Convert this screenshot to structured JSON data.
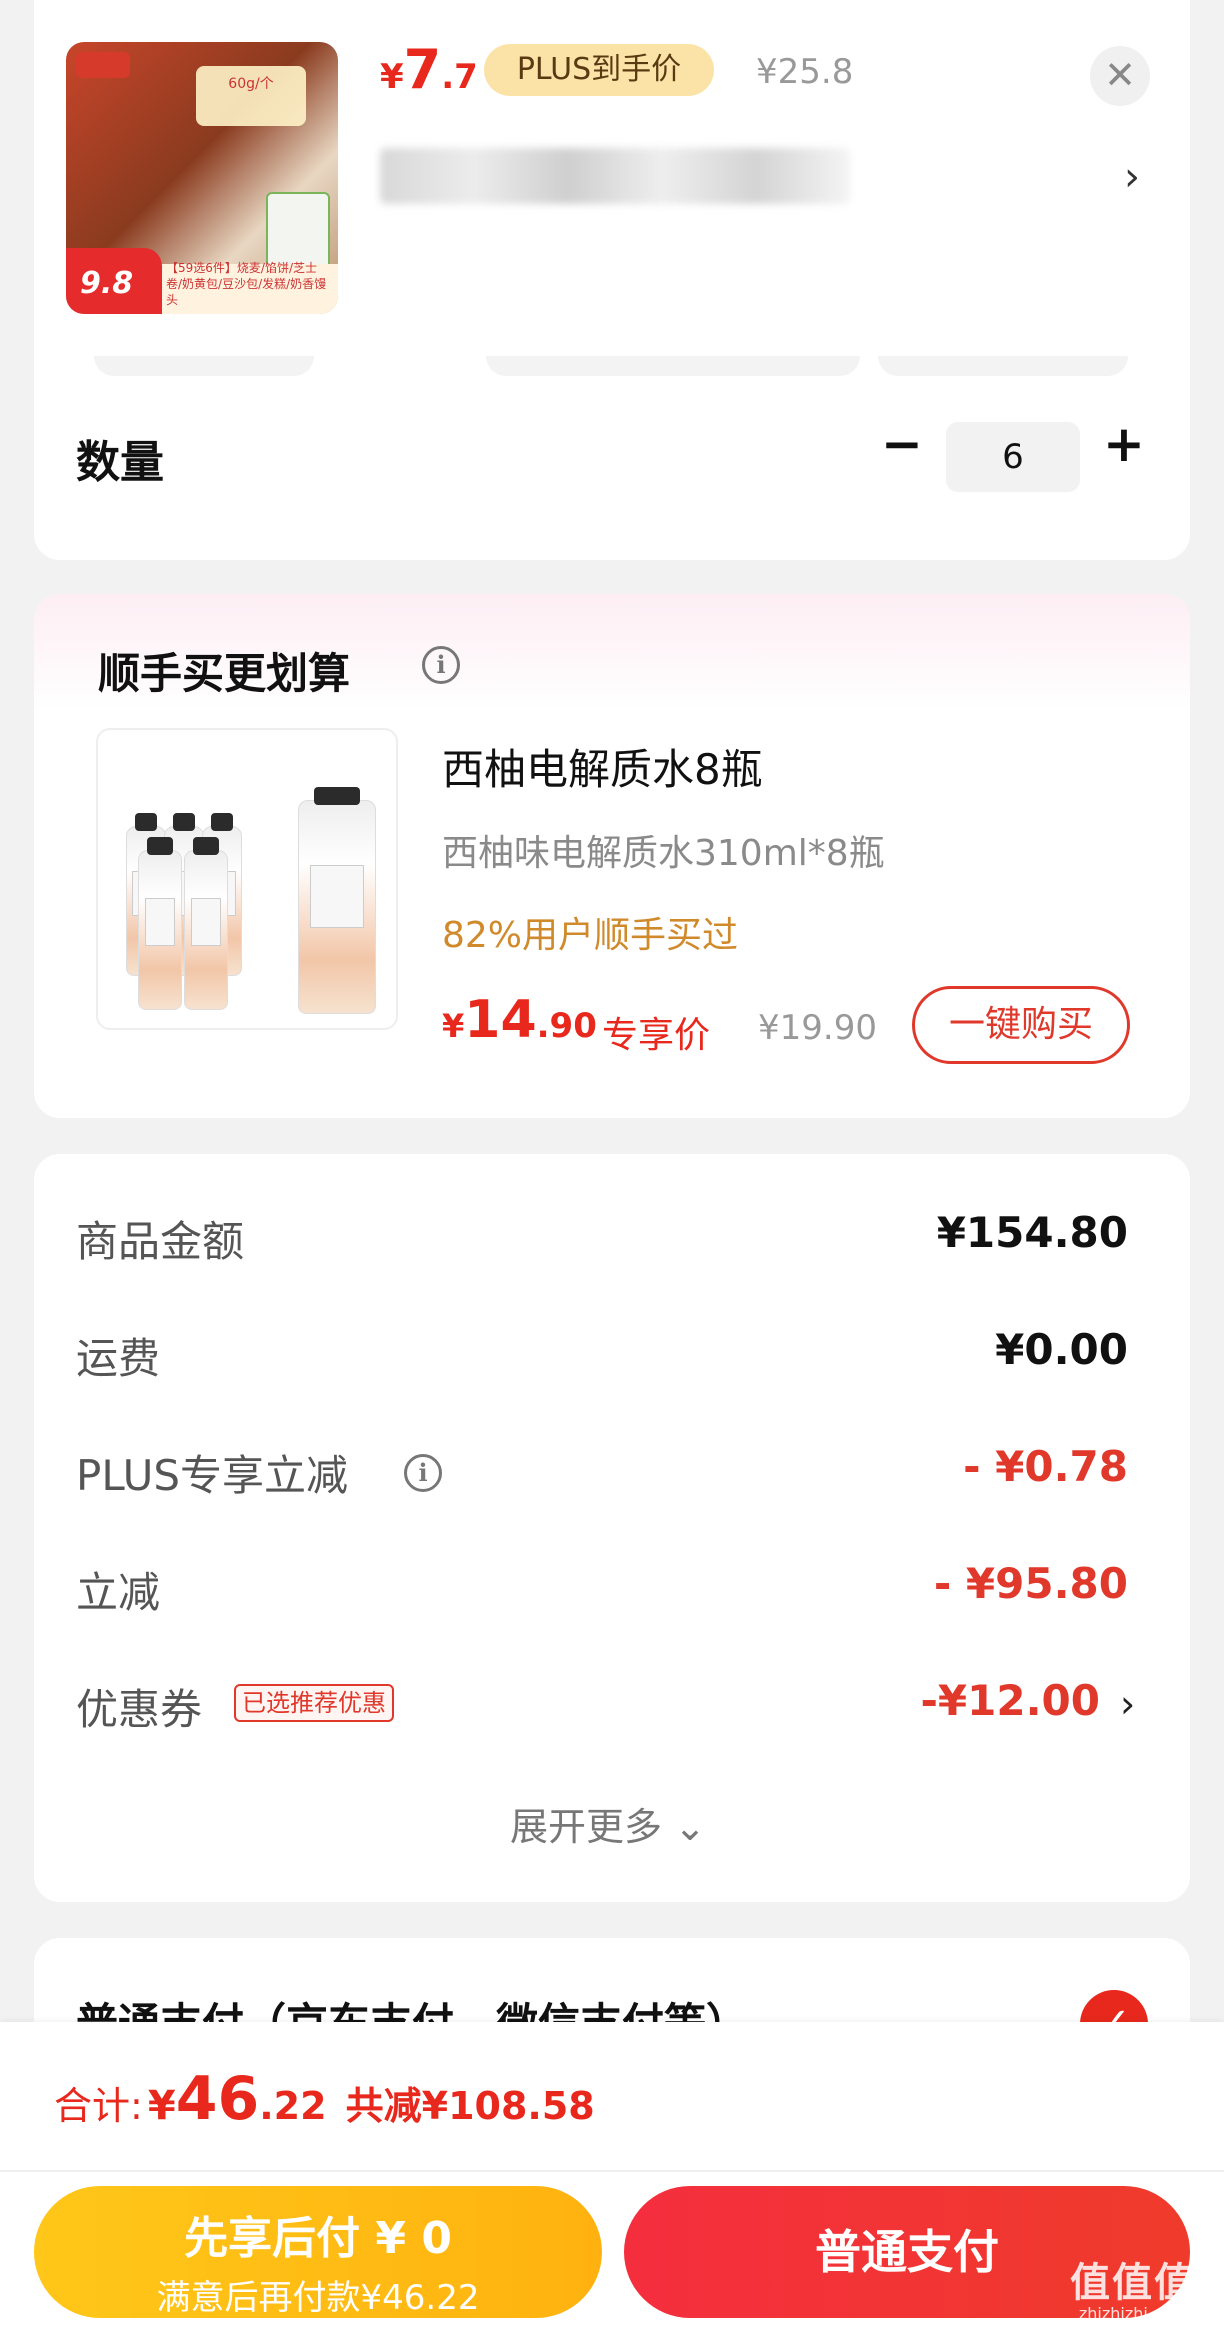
{
  "header": {
    "thumb": {
      "badge_price": "9.8",
      "top_label": "60g/个",
      "band_text": "【59选6件】烧麦/馅饼/芝士卷/奶黄包/豆沙包/发糕/奶香馒头"
    },
    "price": {
      "currency": "¥",
      "int": "7",
      "dec": ".7"
    },
    "plus_label": "PLUS到手价",
    "original_price": "¥25.8",
    "close_symbol": "✕",
    "chevron": "›"
  },
  "quantity": {
    "label": "数量",
    "minus": "−",
    "value": "6",
    "plus": "+"
  },
  "addon": {
    "title": "顺手买更划算",
    "info_symbol": "i",
    "product_name": "西柚电解质水8瓶",
    "product_desc": "西柚味电解质水310ml*8瓶",
    "stat": "82%用户顺手买过",
    "price": {
      "currency": "¥",
      "int": "14",
      "dec": ".90"
    },
    "price_label": "专享价",
    "original_price": "¥19.90",
    "buy_button": "一键购买"
  },
  "summary": {
    "rows": [
      {
        "label": "商品金额",
        "value": "¥154.80"
      },
      {
        "label": "运费",
        "value": "¥0.00"
      },
      {
        "label": "PLUS专享立减",
        "value": "- ¥0.78"
      },
      {
        "label": "立减",
        "value": "- ¥95.80"
      },
      {
        "label": "优惠券",
        "value": "-¥12.00",
        "badge": "已选推荐优惠"
      }
    ],
    "expand_more": "展开更多 ⌄",
    "coupon_chevron": "›"
  },
  "payment": {
    "title": "普通支付（京东支付、微信支付等）",
    "check_symbol": "✓"
  },
  "bottom": {
    "total_label": "合计:",
    "total": {
      "currency": "¥",
      "int": "46",
      "dec": ".22"
    },
    "saved": "共减¥108.58",
    "later_pay": {
      "line1": "先享后付 ¥ 0",
      "line2": "满意后再付款¥46.22"
    },
    "normal_pay": "普通支付"
  },
  "watermark": {
    "line1": "值值值",
    "line2": "zhizhizhi.com"
  },
  "colors": {
    "accent_red": "#e8281c",
    "plus_gold": "#fbe3a8",
    "stat_orange": "#d08a2c",
    "later_yellow": "#ffc719"
  }
}
